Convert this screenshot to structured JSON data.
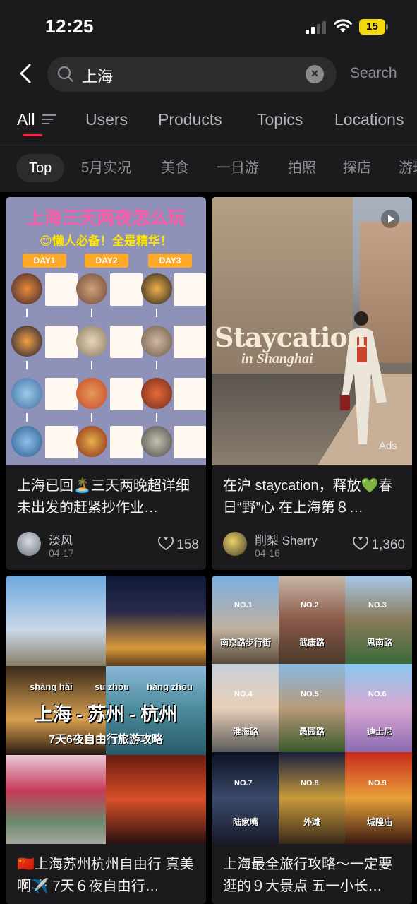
{
  "status_bar": {
    "time": "12:25",
    "battery": "15"
  },
  "search": {
    "query": "上海",
    "button": "Search"
  },
  "tabs": [
    {
      "label": "All",
      "active": true
    },
    {
      "label": "Users"
    },
    {
      "label": "Products"
    },
    {
      "label": "Topics"
    },
    {
      "label": "Locations"
    }
  ],
  "chips": [
    {
      "label": "Top",
      "active": true
    },
    {
      "label": "5月实况"
    },
    {
      "label": "美食"
    },
    {
      "label": "一日游"
    },
    {
      "label": "拍照"
    },
    {
      "label": "探店"
    },
    {
      "label": "游玩"
    }
  ],
  "posts": [
    {
      "title": "上海已回🏝️三天两晚超详细 未出发的赶紧抄作业…",
      "author": "淡风",
      "date": "04-17",
      "likes": "158",
      "cover": {
        "heading": "上海三天两夜怎么玩",
        "subheading": "😊懒人必备！全是精华！",
        "days": [
          "DAY1",
          "DAY2",
          "DAY3"
        ]
      }
    },
    {
      "title": "在沪 staycation，释放💚春日“野”心 在上海第８…",
      "author": "削梨 Sherry",
      "date": "04-16",
      "likes": "1,360",
      "cover": {
        "headline": "Staycation",
        "subline": "in Shanghai",
        "badge": "Ads"
      }
    },
    {
      "title": "🇨🇳上海苏州杭州自由行 真美啊✈️ 7天６夜自由行…",
      "cover": {
        "headline": "上海 - 苏州 - 杭州",
        "pinyin": [
          "shàng hǎi",
          "sū zhōu",
          "háng zhōu"
        ],
        "subline": "7天6夜自由行旅游攻略"
      }
    },
    {
      "title": "上海最全旅行攻略～一定要逛的９大景点 五一小长…",
      "cover": {
        "spots": [
          {
            "no": "NO.1",
            "name": "南京路步行街"
          },
          {
            "no": "NO.2",
            "name": "武康路"
          },
          {
            "no": "NO.3",
            "name": "思南路"
          },
          {
            "no": "NO.4",
            "name": "淮海路"
          },
          {
            "no": "NO.5",
            "name": "愚园路"
          },
          {
            "no": "NO.6",
            "name": "迪士尼"
          },
          {
            "no": "NO.7",
            "name": "陆家嘴"
          },
          {
            "no": "NO.8",
            "name": "外滩"
          },
          {
            "no": "NO.9",
            "name": "城隍庙"
          }
        ]
      }
    }
  ]
}
